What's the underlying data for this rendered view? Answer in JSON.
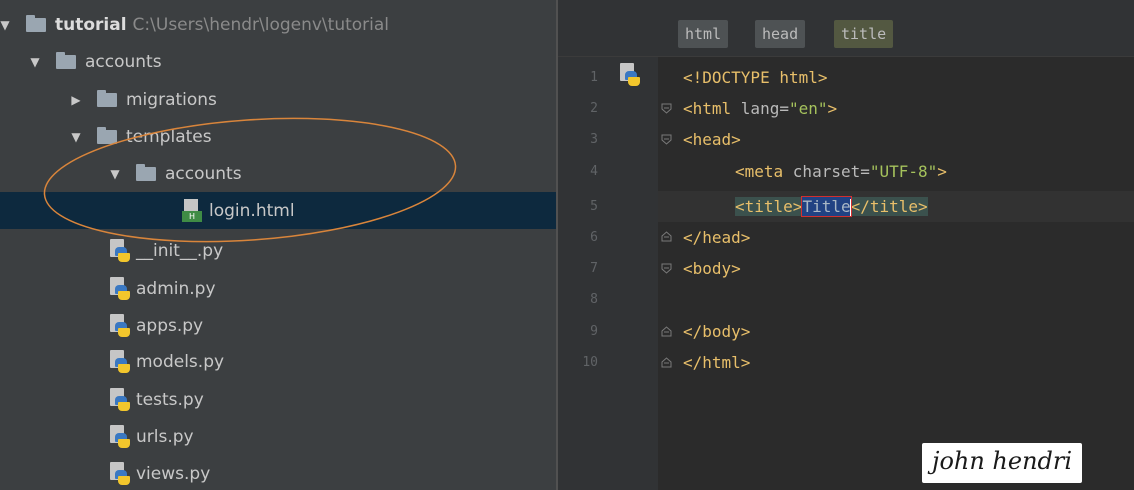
{
  "project_tree": {
    "root": {
      "name": "tutorial",
      "path": "C:\\Users\\hendr\\logenv\\tutorial"
    },
    "items": [
      {
        "label": "accounts",
        "kind": "folder",
        "expanded": true
      },
      {
        "label": "migrations",
        "kind": "folder",
        "expanded": false
      },
      {
        "label": "templates",
        "kind": "folder",
        "expanded": true
      },
      {
        "label": "accounts",
        "kind": "folder",
        "expanded": true
      },
      {
        "label": "login.html",
        "kind": "html",
        "selected": true
      },
      {
        "label": "__init__.py",
        "kind": "python"
      },
      {
        "label": "admin.py",
        "kind": "python"
      },
      {
        "label": "apps.py",
        "kind": "python"
      },
      {
        "label": "models.py",
        "kind": "python"
      },
      {
        "label": "tests.py",
        "kind": "python"
      },
      {
        "label": "urls.py",
        "kind": "python"
      },
      {
        "label": "views.py",
        "kind": "python"
      }
    ],
    "html_badge": "H"
  },
  "editor": {
    "breadcrumbs": [
      "html",
      "head",
      "title"
    ],
    "line_numbers": [
      "1",
      "2",
      "3",
      "4",
      "5",
      "6",
      "7",
      "8",
      "9",
      "10"
    ],
    "code": {
      "l1": "<!DOCTYPE html>",
      "l2_open": "<html ",
      "l2_attr": "lang=",
      "l2_val": "\"en\"",
      "l2_close": ">",
      "l3": "<head>",
      "l4_open": "<meta ",
      "l4_attr": "charset=",
      "l4_val": "\"UTF-8\"",
      "l4_close": ">",
      "l5_open": "<title>",
      "l5_text": "Title",
      "l5_close": "</title>",
      "l6": "</head>",
      "l7": "<body>",
      "l9": "</body>",
      "l10": "</html>"
    }
  },
  "signature": "john hendri",
  "colors": {
    "tree_bg": "#3c3f41",
    "editor_bg": "#2b2b2b",
    "selection": "#0d293e",
    "annotation": "#d9853b"
  }
}
